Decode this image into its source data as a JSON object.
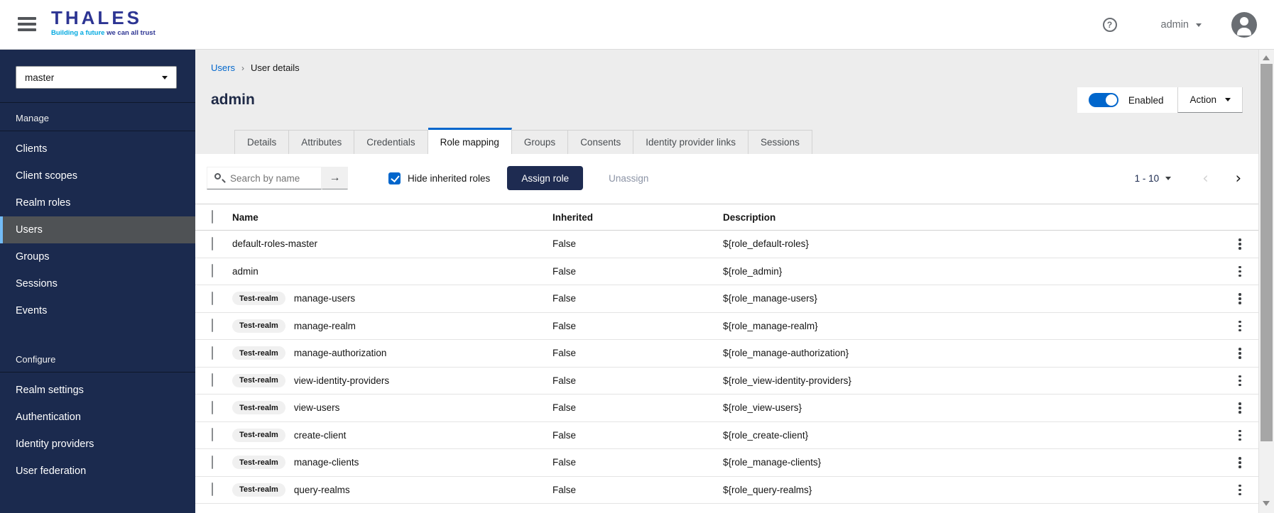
{
  "topbar": {
    "brand": {
      "name": "THALES",
      "tagline_accent": "Building a future",
      "tagline_rest": "we can all trust"
    },
    "help_label": "?",
    "user": {
      "label": "admin"
    }
  },
  "sidebar": {
    "realm_selector": {
      "value": "master"
    },
    "sections": [
      {
        "label": "Manage",
        "items": [
          {
            "label": "Clients",
            "active": false
          },
          {
            "label": "Client scopes",
            "active": false
          },
          {
            "label": "Realm roles",
            "active": false
          },
          {
            "label": "Users",
            "active": true
          },
          {
            "label": "Groups",
            "active": false
          },
          {
            "label": "Sessions",
            "active": false
          },
          {
            "label": "Events",
            "active": false
          }
        ]
      },
      {
        "label": "Configure",
        "items": [
          {
            "label": "Realm settings",
            "active": false
          },
          {
            "label": "Authentication",
            "active": false
          },
          {
            "label": "Identity providers",
            "active": false
          },
          {
            "label": "User federation",
            "active": false
          }
        ]
      }
    ]
  },
  "page": {
    "breadcrumb": {
      "parent": "Users",
      "current": "User details"
    },
    "title": "admin",
    "enabled_toggle": {
      "label": "Enabled",
      "on": true
    },
    "action_menu": {
      "label": "Action"
    }
  },
  "tabs": [
    {
      "label": "Details",
      "active": false
    },
    {
      "label": "Attributes",
      "active": false
    },
    {
      "label": "Credentials",
      "active": false
    },
    {
      "label": "Role mapping",
      "active": true
    },
    {
      "label": "Groups",
      "active": false
    },
    {
      "label": "Consents",
      "active": false
    },
    {
      "label": "Identity provider links",
      "active": false
    },
    {
      "label": "Sessions",
      "active": false
    }
  ],
  "toolbar": {
    "search": {
      "placeholder": "Search by name",
      "value": ""
    },
    "hide_inherited": {
      "label": "Hide inherited roles",
      "checked": true
    },
    "assign_label": "Assign role",
    "unassign_label": "Unassign",
    "pagination": {
      "range": "1 - 10",
      "prev_enabled": false,
      "next_enabled": true
    }
  },
  "table": {
    "columns": {
      "name": "Name",
      "inherited": "Inherited",
      "description": "Description"
    },
    "rows": [
      {
        "badge": "",
        "name": "default-roles-master",
        "inherited": "False",
        "description": "${role_default-roles}"
      },
      {
        "badge": "",
        "name": "admin",
        "inherited": "False",
        "description": "${role_admin}"
      },
      {
        "badge": "Test-realm",
        "name": "manage-users",
        "inherited": "False",
        "description": "${role_manage-users}"
      },
      {
        "badge": "Test-realm",
        "name": "manage-realm",
        "inherited": "False",
        "description": "${role_manage-realm}"
      },
      {
        "badge": "Test-realm",
        "name": "manage-authorization",
        "inherited": "False",
        "description": "${role_manage-authorization}"
      },
      {
        "badge": "Test-realm",
        "name": "view-identity-providers",
        "inherited": "False",
        "description": "${role_view-identity-providers}"
      },
      {
        "badge": "Test-realm",
        "name": "view-users",
        "inherited": "False",
        "description": "${role_view-users}"
      },
      {
        "badge": "Test-realm",
        "name": "create-client",
        "inherited": "False",
        "description": "${role_create-client}"
      },
      {
        "badge": "Test-realm",
        "name": "manage-clients",
        "inherited": "False",
        "description": "${role_manage-clients}"
      },
      {
        "badge": "Test-realm",
        "name": "query-realms",
        "inherited": "False",
        "description": "${role_query-realms}"
      }
    ]
  },
  "colors": {
    "sidebar_navy": "#1b2a4e",
    "accent_blue": "#0066cc",
    "thales_blue": "#2d3593",
    "thales_cyan": "#00a9e0",
    "selected_nav_bg": "#4f5255",
    "selected_nav_border": "#73bcf7",
    "page_bg": "#ededed",
    "primary_button": "#1e2b51"
  }
}
